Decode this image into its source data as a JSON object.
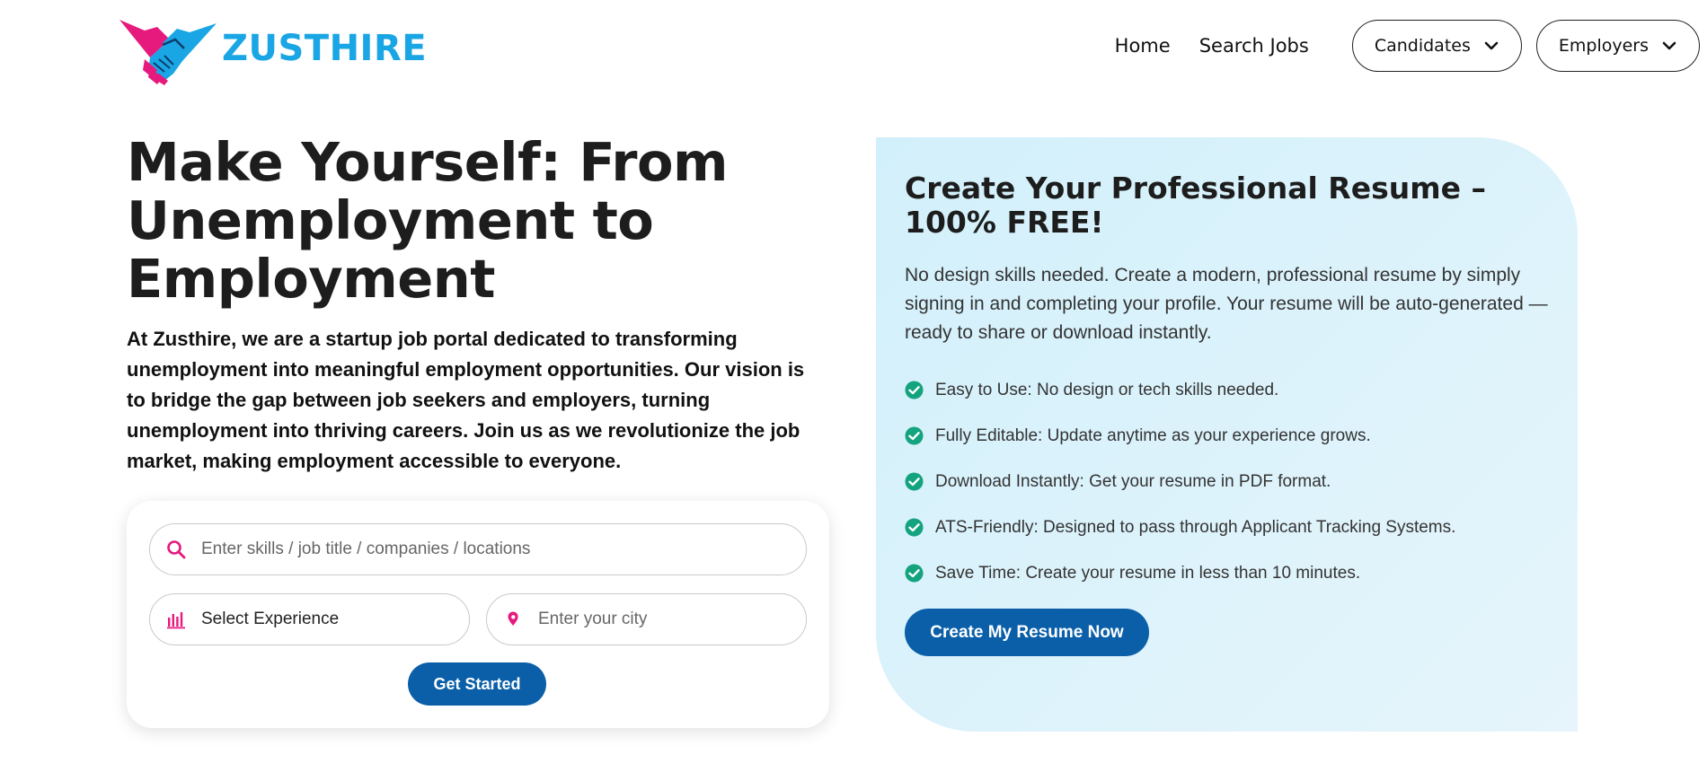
{
  "brand": {
    "name": "ZUSTHIRE",
    "logo_icon": "handshake-icon",
    "colors": {
      "pink": "#e6197d",
      "blue": "#1aa6e4"
    }
  },
  "nav": {
    "home": "Home",
    "search_jobs": "Search Jobs",
    "candidates": "Candidates",
    "employers": "Employers"
  },
  "hero": {
    "title": "Make Yourself: From Unemployment to Employment",
    "description": "At Zusthire, we are a startup job portal dedicated to transforming unemployment into meaningful employment opportunities. Our vision is to bridge the gap between job seekers and employers, turning unemployment into thriving careers. Join us as we revolutionize the job market, making employment accessible to everyone."
  },
  "search": {
    "keyword_placeholder": "Enter skills / job title / companies / locations",
    "experience_value": "Select Experience",
    "city_placeholder": "Enter your city",
    "submit_label": "Get Started"
  },
  "resume": {
    "title": "Create Your Professional Resume – 100% FREE!",
    "description": "No design skills needed. Create a modern, professional resume by simply signing in and completing your profile. Your resume will be auto-generated — ready to share or download instantly.",
    "features": [
      "Easy to Use: No design or tech skills needed.",
      "Fully Editable: Update anytime as your experience grows.",
      "Download Instantly: Get your resume in PDF format.",
      "ATS-Friendly: Designed to pass through Applicant Tracking Systems.",
      "Save Time: Create your resume in less than 10 minutes."
    ],
    "cta_label": "Create My Resume Now"
  },
  "theme": {
    "accent": "#0a5fa8",
    "icon_pink": "#e6197d",
    "check_green": "#14a37f",
    "panel_bg": "#d8f2fb"
  }
}
